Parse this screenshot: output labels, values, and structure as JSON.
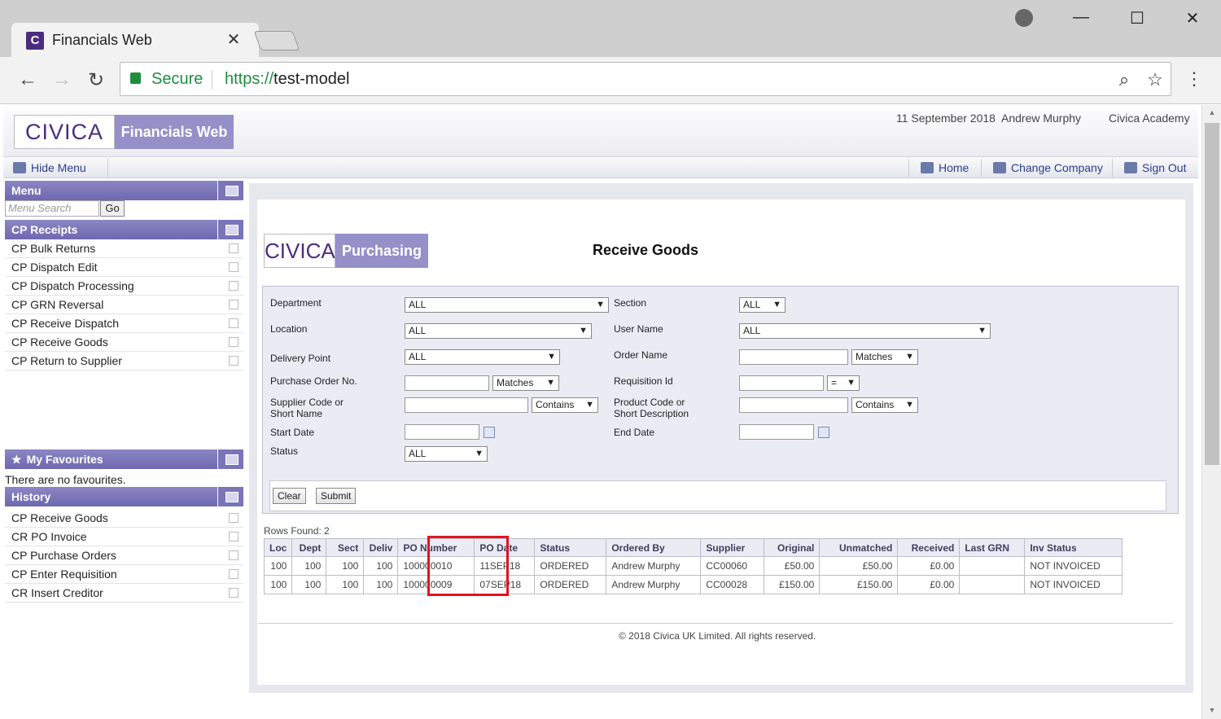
{
  "browser": {
    "tab_title": "Financials Web",
    "tab_favicon": "C",
    "close_glyph": "✕",
    "secure_label": "Secure",
    "url_scheme": "https://",
    "url_host": "test-model",
    "window": {
      "minimize": "—",
      "maximize": "☐",
      "close": "✕"
    },
    "nav": {
      "back": "←",
      "forward": "→",
      "reload": "↻"
    },
    "zoom_glyph": "⌕",
    "star_glyph": "☆",
    "menu_glyph": "⋮"
  },
  "header": {
    "logo_civica": "CIVICA",
    "logo_product": "Financials Web",
    "date": "11 September 2018",
    "user": "Andrew Murphy",
    "company": "Civica Academy"
  },
  "menubar": {
    "hide_menu": "Hide Menu",
    "home": "Home",
    "change_company": "Change Company",
    "sign_out": "Sign Out"
  },
  "sidebar": {
    "menu_title": "Menu",
    "search_placeholder": "Menu Search",
    "go_label": "Go",
    "cp_receipts_title": "CP Receipts",
    "cp_receipts_items": [
      "CP Bulk Returns",
      "CP Dispatch Edit",
      "CP Dispatch Processing",
      "CP GRN Reversal",
      "CP Receive Dispatch",
      "CP Receive Goods",
      "CP Return to Supplier"
    ],
    "favourites_title": "My Favourites",
    "favourites_empty": "There are no favourites.",
    "history_title": "History",
    "history_items": [
      "CP Receive Goods",
      "CR PO Invoice",
      "CP Purchase Orders",
      "CP Enter Requisition",
      "CR Insert Creditor"
    ]
  },
  "main": {
    "logo_civica": "CIVICA",
    "logo_product": "Purchasing",
    "title": "Receive Goods",
    "filters": {
      "department_label": "Department",
      "department_value": "ALL",
      "section_label": "Section",
      "section_value": "ALL",
      "location_label": "Location",
      "location_value": "ALL",
      "user_name_label": "User Name",
      "user_name_value": "ALL",
      "delivery_point_label": "Delivery Point",
      "delivery_point_value": "ALL",
      "order_name_label": "Order Name",
      "order_name_match": "Matches",
      "po_no_label": "Purchase Order No.",
      "po_no_match": "Matches",
      "requisition_label": "Requisition Id",
      "requisition_match": "=",
      "supplier_label_1": "Supplier Code or",
      "supplier_label_2": "Short Name",
      "supplier_match": "Contains",
      "product_label_1": "Product Code or",
      "product_label_2": "Short Description",
      "product_match": "Contains",
      "start_date_label": "Start Date",
      "end_date_label": "End Date",
      "status_label": "Status",
      "status_value": "ALL"
    },
    "clear_label": "Clear",
    "submit_label": "Submit",
    "rows_found": "Rows Found: 2",
    "columns": [
      "Loc",
      "Dept",
      "Sect",
      "Deliv",
      "PO Number",
      "PO Date",
      "Status",
      "Ordered By",
      "Supplier",
      "Original",
      "Unmatched",
      "Received",
      "Last GRN",
      "Inv Status"
    ],
    "rows": [
      [
        "100",
        "100",
        "100",
        "100",
        "100000010",
        "11SEP18",
        "ORDERED",
        "Andrew Murphy",
        "CC00060",
        "£50.00",
        "£50.00",
        "£0.00",
        "",
        "NOT INVOICED"
      ],
      [
        "100",
        "100",
        "100",
        "100",
        "100000009",
        "07SEP18",
        "ORDERED",
        "Andrew Murphy",
        "CC00028",
        "£150.00",
        "£150.00",
        "£0.00",
        "",
        "NOT INVOICED"
      ]
    ],
    "footer": "© 2018 Civica UK Limited. All rights reserved."
  },
  "colors": {
    "accent": "#9590c8",
    "brand": "#4b2d7f",
    "highlight": "#e0141e"
  }
}
